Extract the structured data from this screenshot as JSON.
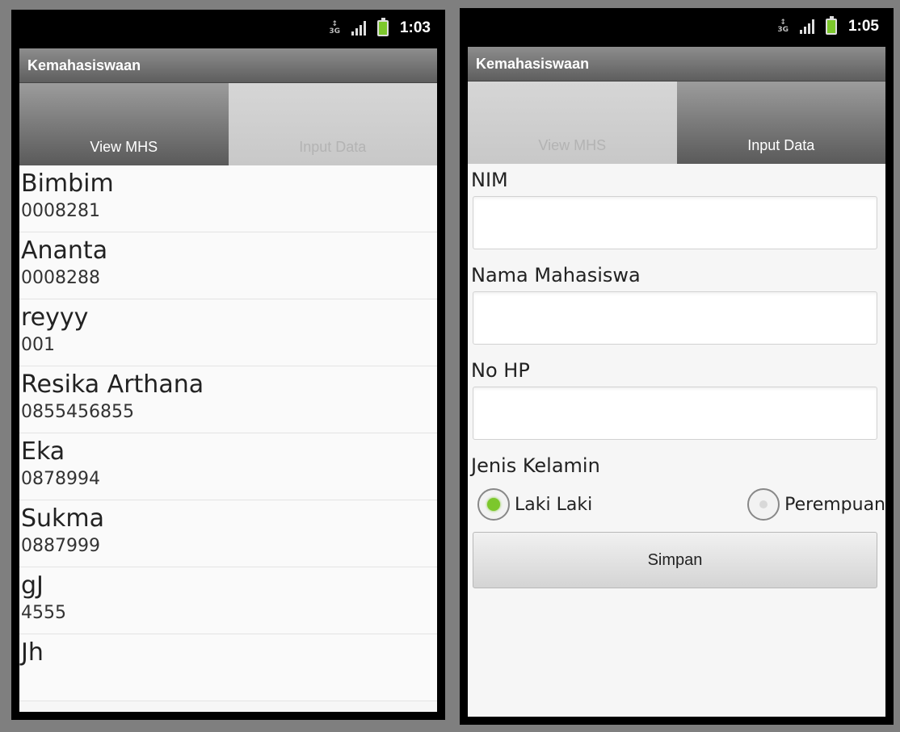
{
  "left": {
    "status": {
      "network": "3G",
      "time": "1:03"
    },
    "app_title": "Kemahasiswaan",
    "tabs": [
      {
        "label": "View MHS",
        "active": true
      },
      {
        "label": "Input Data",
        "active": false
      }
    ],
    "items": [
      {
        "name": "Bimbim",
        "nim": "0008281"
      },
      {
        "name": "Ananta",
        "nim": "0008288"
      },
      {
        "name": "reyyy",
        "nim": "001"
      },
      {
        "name": "Resika Arthana",
        "nim": "0855456855"
      },
      {
        "name": "Eka",
        "nim": "0878994"
      },
      {
        "name": "Sukma",
        "nim": "0887999"
      },
      {
        "name": "gJ",
        "nim": "4555"
      },
      {
        "name": "Jh",
        "nim": ""
      }
    ]
  },
  "right": {
    "status": {
      "network": "3G",
      "time": "1:05"
    },
    "app_title": "Kemahasiswaan",
    "tabs": [
      {
        "label": "View MHS",
        "active": false
      },
      {
        "label": "Input Data",
        "active": true
      }
    ],
    "form": {
      "nim_label": "NIM",
      "nim_value": "",
      "nama_label": "Nama Mahasiswa",
      "nama_value": "",
      "hp_label": "No HP",
      "hp_value": "",
      "gender_label": "Jenis Kelamin",
      "gender_options": [
        {
          "label": "Laki Laki",
          "selected": true
        },
        {
          "label": "Perempuan",
          "selected": false
        }
      ],
      "submit_label": "Simpan"
    }
  },
  "colors": {
    "accent_green": "#7cc72c",
    "bar_gray": "#6f6f6f"
  }
}
